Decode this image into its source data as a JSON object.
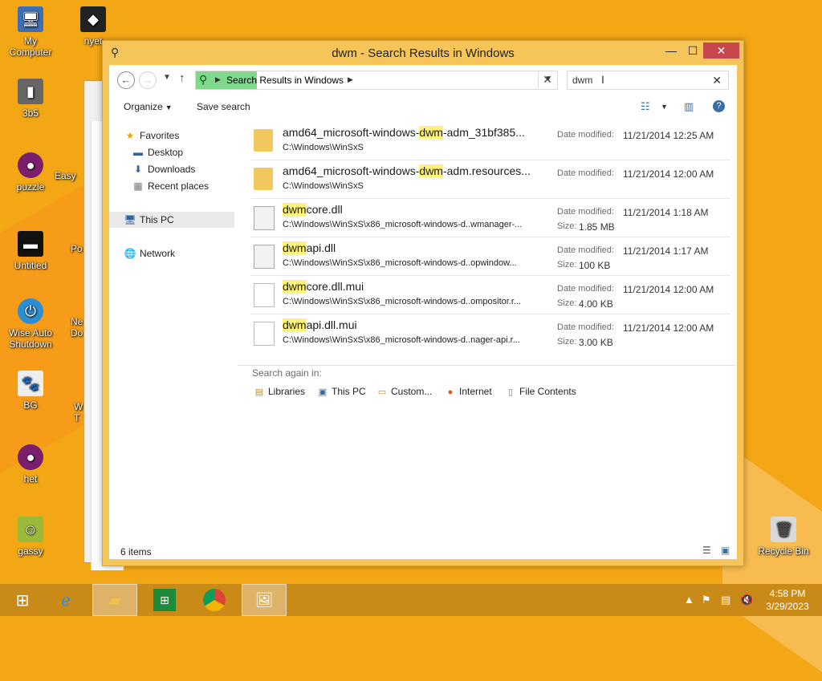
{
  "desktop": {
    "icons": [
      {
        "label": "My Computer",
        "icon": "computer-icon"
      },
      {
        "label": "nyet",
        "icon": "app-icon"
      },
      {
        "label": "3b5",
        "icon": "file-icon"
      },
      {
        "label": "puzzle",
        "icon": "firefox-icon"
      },
      {
        "label": "Easy",
        "icon": "app-icon"
      },
      {
        "label": "Untitled",
        "icon": "image-icon"
      },
      {
        "label": "Po",
        "icon": "app-icon"
      },
      {
        "label": "Wise Auto Shutdown",
        "icon": "shutdown-icon"
      },
      {
        "label": "Ne Do",
        "icon": "app-icon"
      },
      {
        "label": "BG",
        "icon": "cat-icon"
      },
      {
        "label": "W T",
        "icon": "app-icon"
      },
      {
        "label": "het",
        "icon": "firefox-icon"
      },
      {
        "label": "gassy",
        "icon": "image-icon"
      },
      {
        "label": "Recycle Bin",
        "icon": "recycle-bin-icon"
      }
    ]
  },
  "window": {
    "title": "dwm - Search Results in Windows",
    "address": {
      "crumb": "Search Results in Windows",
      "crumb_highlight": "Search"
    },
    "search": {
      "value": "dwm"
    },
    "commands": {
      "organize": "Organize",
      "save_search": "Save search"
    },
    "nav": {
      "favorites": "Favorites",
      "desktop": "Desktop",
      "downloads": "Downloads",
      "recent": "Recent places",
      "this_pc": "This PC",
      "network": "Network"
    },
    "results": [
      {
        "pre": "amd64_microsoft-windows-",
        "hl": "dwm",
        "post": "-adm_31bf385...",
        "path": "C:\\Windows\\WinSxS",
        "date_label": "Date modified:",
        "date": "11/21/2014 12:25 AM",
        "size_label": "",
        "size": "",
        "type": "folder"
      },
      {
        "pre": "amd64_microsoft-windows-",
        "hl": "dwm",
        "post": "-adm.resources...",
        "path": "C:\\Windows\\WinSxS",
        "date_label": "Date modified:",
        "date": "11/21/2014 12:00 AM",
        "size_label": "",
        "size": "",
        "type": "folder"
      },
      {
        "pre": "",
        "hl": "dwm",
        "post": "core.dll",
        "path": "C:\\Windows\\WinSxS\\x86_microsoft-windows-d..wmanager-...",
        "date_label": "Date modified:",
        "date": "11/21/2014 1:18 AM",
        "size_label": "Size:",
        "size": "1.85 MB",
        "type": "dll"
      },
      {
        "pre": "",
        "hl": "dwm",
        "post": "api.dll",
        "path": "C:\\Windows\\WinSxS\\x86_microsoft-windows-d..opwindow...",
        "date_label": "Date modified:",
        "date": "11/21/2014 1:17 AM",
        "size_label": "Size:",
        "size": "100 KB",
        "type": "dll"
      },
      {
        "pre": "",
        "hl": "dwm",
        "post": "core.dll.mui",
        "path": "C:\\Windows\\WinSxS\\x86_microsoft-windows-d..ompositor.r...",
        "date_label": "Date modified:",
        "date": "11/21/2014 12:00 AM",
        "size_label": "Size:",
        "size": "4.00 KB",
        "type": "mui"
      },
      {
        "pre": "",
        "hl": "dwm",
        "post": "api.dll.mui",
        "path": "C:\\Windows\\WinSxS\\x86_microsoft-windows-d..nager-api.r...",
        "date_label": "Date modified:",
        "date": "11/21/2014 12:00 AM",
        "size_label": "Size:",
        "size": "3.00 KB",
        "type": "mui"
      }
    ],
    "search_again": {
      "title": "Search again in:",
      "libraries": "Libraries",
      "this_pc": "This PC",
      "custom": "Custom...",
      "internet": "Internet",
      "file_contents": "File Contents"
    },
    "status": "6 items"
  },
  "taskbar": {
    "time": "4:58 PM",
    "date": "3/29/2023"
  }
}
